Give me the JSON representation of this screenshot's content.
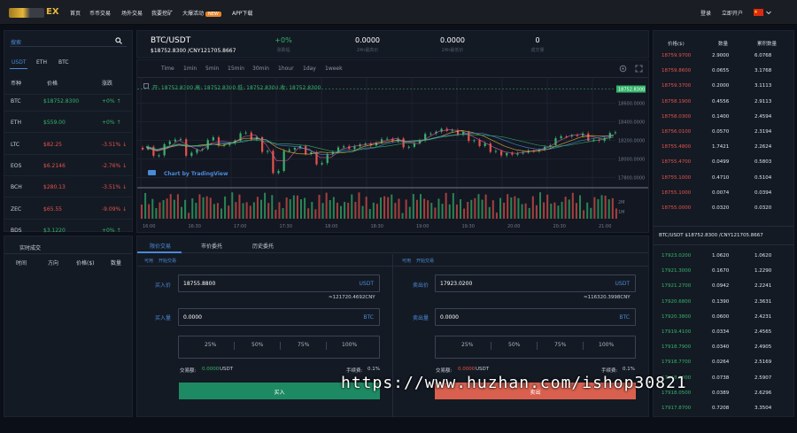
{
  "header": {
    "logo_text": "EX",
    "nav": [
      "首页",
      "币币交易",
      "场外交易",
      "我要挖矿",
      "大爆活动",
      "APP下载"
    ],
    "new_badge": "NEW",
    "login": "登录",
    "register": "立即开户"
  },
  "market": {
    "search_placeholder": "搜索",
    "tabs": [
      "USDT",
      "ETH",
      "BTC"
    ],
    "columns": [
      "币种",
      "价格",
      "涨跌"
    ],
    "rows": [
      {
        "coin": "BTC",
        "price": "$18752.8300",
        "change": "+0% ↑",
        "dir": "up"
      },
      {
        "coin": "ETH",
        "price": "$559.00",
        "change": "+0% ↑",
        "dir": "up"
      },
      {
        "coin": "LTC",
        "price": "$82.25",
        "change": "-3.51% ↓",
        "dir": "down"
      },
      {
        "coin": "EOS",
        "price": "$6.2146",
        "change": "-2.76% ↓",
        "dir": "down"
      },
      {
        "coin": "BCH",
        "price": "$280.13",
        "change": "-3.51% ↓",
        "dir": "down"
      },
      {
        "coin": "ZEC",
        "price": "$65.55",
        "change": "-9.09% ↓",
        "dir": "down"
      },
      {
        "coin": "BDS",
        "price": "$3.1220",
        "change": "+0% ↑",
        "dir": "up"
      },
      {
        "coin": "",
        "price": "$0.2166",
        "change": "+0% ↑",
        "dir": "up"
      }
    ]
  },
  "ticker": {
    "pair": "BTC/USDT",
    "price_line": "$18752.8300 /CNY121705.8667",
    "change": "+0%",
    "change_label": "涨跌幅",
    "high": "0.0000",
    "high_label": "24h最高价",
    "low": "0.0000",
    "low_label": "24h最低价",
    "volume": "0",
    "volume_label": "成交量"
  },
  "chart": {
    "timeframes": [
      "Time",
      "1min",
      "5min",
      "15min",
      "30min",
      "1hour",
      "1day",
      "1week"
    ],
    "ohlc_line": "开: 18752.8300  高: 18752.8300  低: 18752.8300  收: 18752.8300",
    "current_price_tag": "18752.8300",
    "y_ticks": [
      "18600.0000",
      "18400.0000",
      "18200.0000",
      "18000.0000",
      "17800.0000"
    ],
    "vol_ticks": [
      "2M",
      "1M"
    ],
    "x_ticks": [
      "16:00",
      "16:30",
      "17:00",
      "17:30",
      "18:00",
      "18:30",
      "19:00",
      "19:30",
      "20:00",
      "20:30",
      "21:00"
    ],
    "watermark": "Chart by TradingView",
    "chart_data": {
      "type": "line",
      "series": [
        {
          "values": [
            18120,
            18050,
            18180,
            18220,
            18060,
            18110,
            18230,
            18150,
            18200,
            18280,
            18240,
            18080,
            17880,
            18090,
            18150,
            18060,
            17970,
            18060,
            18150,
            18120,
            18180,
            18160,
            18230,
            18210,
            18140,
            18190,
            18280,
            18320,
            18310,
            18290,
            18200,
            18170,
            18080,
            18070,
            18050,
            18100,
            18090,
            18160,
            18230,
            18270,
            18260,
            18220,
            18210,
            18300
          ]
        }
      ],
      "ylim": [
        17700,
        18700
      ]
    }
  },
  "recent": {
    "title": "实时成交",
    "columns": [
      "时间",
      "方向",
      "价格($)",
      "数量"
    ]
  },
  "trade": {
    "tabs": [
      "限价交易",
      "市价委托",
      "历史委托"
    ],
    "buy_hint_prefix": "可用",
    "buy_hint": "开始交易",
    "buy_price_label": "买入价",
    "buy_price": "18755.8800",
    "buy_price_unit": "USDT",
    "buy_cny": "≈121720.4692CNY",
    "buy_amount_label": "买入量",
    "buy_amount": "0.0000",
    "buy_amount_unit": "BTC",
    "sell_price_label": "卖出价",
    "sell_price": "17923.0200",
    "sell_price_unit": "USDT",
    "sell_cny": "≈116320.3998CNY",
    "sell_amount_label": "卖出量",
    "sell_amount": "0.0000",
    "sell_amount_unit": "BTC",
    "percents": [
      "25%",
      "50%",
      "75%",
      "100%"
    ],
    "turnover_label": "交易额:",
    "buy_turnover": "0.0000",
    "sell_turnover": "0.0000",
    "turnover_unit": "USDT",
    "fee_label": "手续费:",
    "fee": "0.1%",
    "buy_button": "买入",
    "sell_button": "卖出"
  },
  "orderbook": {
    "columns": [
      "价格($)",
      "数量",
      "累积数量"
    ],
    "asks": [
      {
        "price": "18759.9700",
        "qty": "2.9000",
        "total": "6.0768"
      },
      {
        "price": "18759.8600",
        "qty": "0.0655",
        "total": "3.1768"
      },
      {
        "price": "18759.3700",
        "qty": "0.2000",
        "total": "3.1113"
      },
      {
        "price": "18758.1900",
        "qty": "0.4556",
        "total": "2.9113"
      },
      {
        "price": "18758.0300",
        "qty": "0.1400",
        "total": "2.4594"
      },
      {
        "price": "18756.0100",
        "qty": "0.0570",
        "total": "2.3194"
      },
      {
        "price": "18755.4800",
        "qty": "1.7421",
        "total": "2.2624"
      },
      {
        "price": "18755.4700",
        "qty": "0.0499",
        "total": "0.5803"
      },
      {
        "price": "18755.1000",
        "qty": "0.4710",
        "total": "0.5104"
      },
      {
        "price": "18755.1000",
        "qty": "0.0074",
        "total": "0.0394"
      },
      {
        "price": "18755.0000",
        "qty": "0.0320",
        "total": "0.0320"
      }
    ],
    "mid_line": "BTC/USDT $18752.8300 /CNY121705.8667",
    "bids": [
      {
        "price": "17923.0200",
        "qty": "1.0620",
        "total": "1.0620"
      },
      {
        "price": "17921.3000",
        "qty": "0.1670",
        "total": "1.2290"
      },
      {
        "price": "17921.2700",
        "qty": "0.0942",
        "total": "2.2241"
      },
      {
        "price": "17920.6800",
        "qty": "0.1390",
        "total": "2.3631"
      },
      {
        "price": "17920.3800",
        "qty": "0.0600",
        "total": "2.4231"
      },
      {
        "price": "17919.4100",
        "qty": "0.0334",
        "total": "2.4565"
      },
      {
        "price": "17918.7900",
        "qty": "0.0340",
        "total": "2.4905"
      },
      {
        "price": "17918.7700",
        "qty": "0.0264",
        "total": "2.5169"
      },
      {
        "price": "17918.2000",
        "qty": "0.0738",
        "total": "2.5907"
      },
      {
        "price": "17918.0500",
        "qty": "0.0389",
        "total": "2.6296"
      },
      {
        "price": "17917.8700",
        "qty": "0.7208",
        "total": "3.3504"
      }
    ]
  },
  "watermark": "https://www.huzhan.com/ishop30821",
  "colors": {
    "up": "#33b56a",
    "down": "#e6534a",
    "accent": "#e7b73a",
    "buy": "#1e8a63",
    "sell": "#d9604f"
  }
}
